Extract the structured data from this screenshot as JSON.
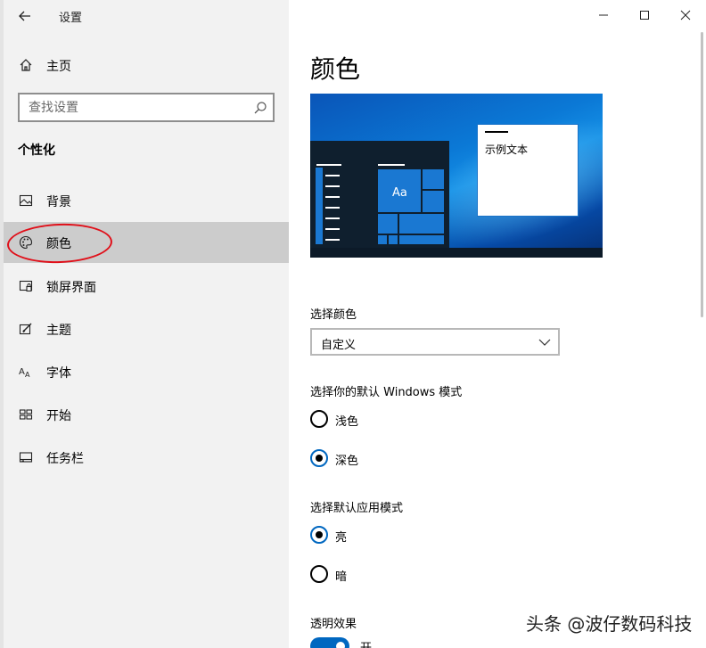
{
  "window": {
    "title": "设置",
    "controls": [
      "minimize",
      "maximize",
      "close"
    ]
  },
  "sidebar": {
    "home": {
      "label": "主页",
      "icon": "home-icon"
    },
    "search": {
      "placeholder": "查找设置",
      "value": ""
    },
    "section_title": "个性化",
    "items": [
      {
        "label": "背景",
        "icon": "picture-icon",
        "selected": false
      },
      {
        "label": "颜色",
        "icon": "palette-icon",
        "selected": true
      },
      {
        "label": "锁屏界面",
        "icon": "lock-screen-icon",
        "selected": false
      },
      {
        "label": "主题",
        "icon": "theme-icon",
        "selected": false
      },
      {
        "label": "字体",
        "icon": "font-icon",
        "selected": false
      },
      {
        "label": "开始",
        "icon": "start-icon",
        "selected": false
      },
      {
        "label": "任务栏",
        "icon": "taskbar-icon",
        "selected": false
      }
    ]
  },
  "main": {
    "title": "颜色",
    "preview": {
      "tile_text": "Aa",
      "sample_text": "示例文本"
    },
    "choose_color": {
      "label": "选择颜色",
      "selected": "自定义"
    },
    "windows_mode": {
      "label": "选择你的默认 Windows 模式",
      "options": [
        {
          "label": "浅色",
          "checked": false
        },
        {
          "label": "深色",
          "checked": true
        }
      ]
    },
    "app_mode": {
      "label": "选择默认应用模式",
      "options": [
        {
          "label": "亮",
          "checked": true
        },
        {
          "label": "暗",
          "checked": false
        }
      ]
    },
    "transparency": {
      "label": "透明效果",
      "state_label": "开",
      "on": true
    }
  },
  "watermark": "头条 @波仔数码科技",
  "colors": {
    "accent": "#0067c0",
    "sidebar_bg": "#f2f2f2",
    "selected_bg": "#cccccc",
    "annotation": "#e0101a"
  }
}
